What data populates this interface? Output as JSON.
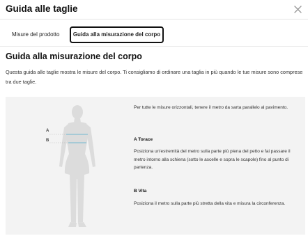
{
  "modal": {
    "title": "Guida alle taglie",
    "close_icon": "close-icon"
  },
  "tabs": [
    {
      "label": "Misure del prodotto",
      "active": false
    },
    {
      "label": "Guida alla misurazione del corpo",
      "active": true
    }
  ],
  "content": {
    "heading": "Guida alla misurazione del corpo",
    "intro": "Questa guida alle taglie mostra le misure del corpo. Ti consigliamo di ordinare una taglia in più quando le tue misure sono comprese tra due taglie.",
    "figure": {
      "marker_a": "A",
      "marker_b": "B"
    },
    "general_note": "Per tutte le misure orizzontali, tenere il metro da sarta parallelo al pavimento.",
    "sections": [
      {
        "title": "A Torace",
        "text": "Posiziona un'estremità del metro sulla parte più piena del petto e fai passare il metro intorno alla schiena (sotto le ascelle e sopra le scapole) fino al punto di partenza."
      },
      {
        "title": "B Vita",
        "text": "Posiziona il metro sulla parte più stretta della vita e misura la circonferenza."
      }
    ]
  },
  "colors": {
    "panel_bg": "#f3f3f3",
    "silhouette": "#dcdcdc",
    "measure_line": "#6fb7cf",
    "active_tab_border": "#111111"
  }
}
